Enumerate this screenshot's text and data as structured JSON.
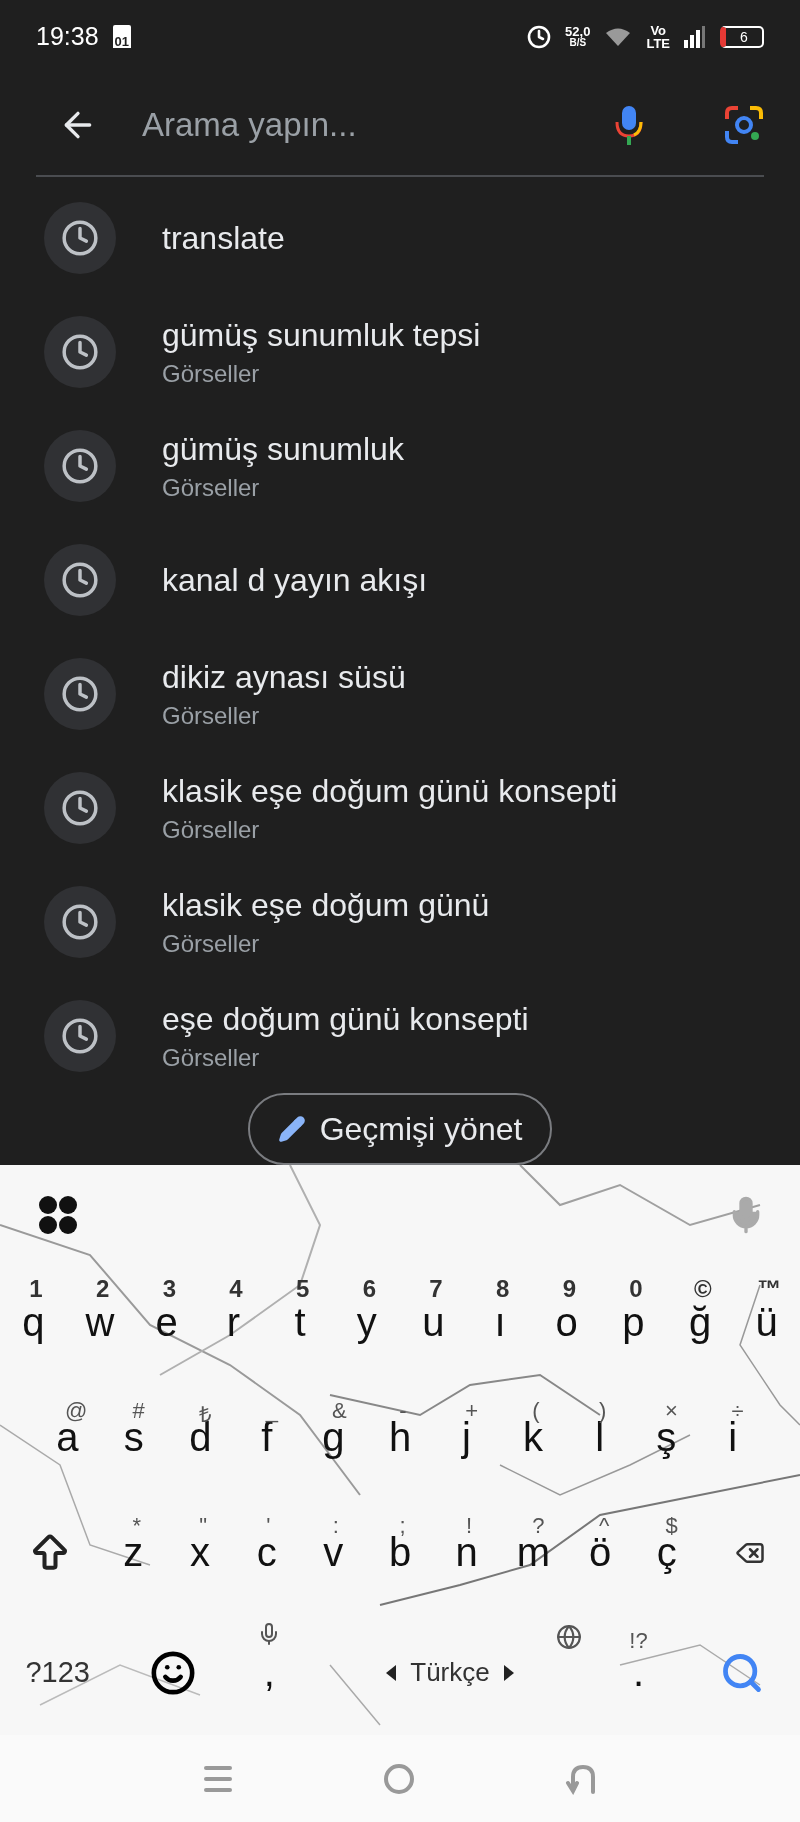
{
  "status_bar": {
    "time": "19:38",
    "calendar_day": "01",
    "net_speed": "52,0",
    "net_unit": "B/S",
    "volte_top": "Vo",
    "volte_bottom": "LTE",
    "battery": "6"
  },
  "search": {
    "placeholder": "Arama yapın..."
  },
  "history": [
    {
      "query": "translate"
    },
    {
      "query": "gümüş sunumluk tepsi",
      "subtitle": "Görseller"
    },
    {
      "query": "gümüş sunumluk",
      "subtitle": "Görseller"
    },
    {
      "query": "kanal d yayın akışı"
    },
    {
      "query": "dikiz aynası süsü",
      "subtitle": "Görseller"
    },
    {
      "query": "klasik eşe doğum günü konsepti",
      "subtitle": "Görseller"
    },
    {
      "query": "klasik eşe doğum günü",
      "subtitle": "Görseller"
    },
    {
      "query": "eşe doğum günü konsepti",
      "subtitle": "Görseller"
    }
  ],
  "manage_button": "Geçmişi yönet",
  "keyboard": {
    "rows": [
      {
        "keys": [
          {
            "kind": "letter",
            "label": "q",
            "hint": "1"
          },
          {
            "kind": "letter",
            "label": "w",
            "hint": "2"
          },
          {
            "kind": "letter",
            "label": "e",
            "hint": "3"
          },
          {
            "kind": "letter",
            "label": "r",
            "hint": "4"
          },
          {
            "kind": "letter",
            "label": "t",
            "hint": "5"
          },
          {
            "kind": "letter",
            "label": "y",
            "hint": "6"
          },
          {
            "kind": "letter",
            "label": "u",
            "hint": "7"
          },
          {
            "kind": "letter",
            "label": "ı",
            "hint": "8"
          },
          {
            "kind": "letter",
            "label": "o",
            "hint": "9"
          },
          {
            "kind": "letter",
            "label": "p",
            "hint": "0"
          },
          {
            "kind": "letter",
            "label": "ğ",
            "hint": "©"
          },
          {
            "kind": "letter",
            "label": "ü",
            "hint": "™"
          }
        ]
      },
      {
        "keys": [
          {
            "kind": "letter",
            "label": "a",
            "hint": "@"
          },
          {
            "kind": "letter",
            "label": "s",
            "hint": "#"
          },
          {
            "kind": "letter",
            "label": "d",
            "hint": "₺"
          },
          {
            "kind": "letter",
            "label": "f",
            "hint": "_"
          },
          {
            "kind": "letter",
            "label": "g",
            "hint": "&"
          },
          {
            "kind": "letter",
            "label": "h",
            "hint": "-"
          },
          {
            "kind": "letter",
            "label": "j",
            "hint": "+"
          },
          {
            "kind": "letter",
            "label": "k",
            "hint": "("
          },
          {
            "kind": "letter",
            "label": "l",
            "hint": ")"
          },
          {
            "kind": "letter",
            "label": "ş",
            "hint": "×"
          },
          {
            "kind": "letter",
            "label": "i",
            "hint": "÷"
          }
        ]
      },
      {
        "keys": [
          {
            "kind": "shift"
          },
          {
            "kind": "letter",
            "label": "z",
            "hint": "*"
          },
          {
            "kind": "letter",
            "label": "x",
            "hint": "\""
          },
          {
            "kind": "letter",
            "label": "c",
            "hint": "'"
          },
          {
            "kind": "letter",
            "label": "v",
            "hint": ":"
          },
          {
            "kind": "letter",
            "label": "b",
            "hint": ";"
          },
          {
            "kind": "letter",
            "label": "n",
            "hint": "!"
          },
          {
            "kind": "letter",
            "label": "m",
            "hint": "?"
          },
          {
            "kind": "letter",
            "label": "ö",
            "hint": "^"
          },
          {
            "kind": "letter",
            "label": "ç",
            "hint": "$"
          },
          {
            "kind": "backspace"
          }
        ]
      },
      {
        "keys": [
          {
            "kind": "symbols",
            "label": "?123"
          },
          {
            "kind": "emoji"
          },
          {
            "kind": "comma",
            "label": ","
          },
          {
            "kind": "space",
            "label": "Türkçe"
          },
          {
            "kind": "period",
            "label": ".",
            "hint": "!?"
          },
          {
            "kind": "search"
          }
        ]
      }
    ]
  }
}
